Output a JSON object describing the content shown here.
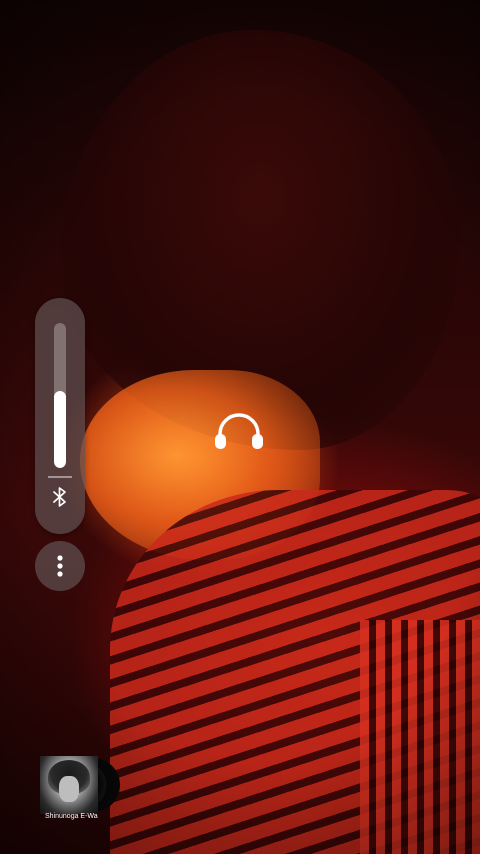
{
  "player": {
    "track_caption": "Shinunoga E-Wa",
    "output_device_icon": "headphones-icon",
    "volume_level": 0.53
  },
  "controls": {
    "bluetooth_icon": "bluetooth-icon",
    "more_icon": "more-vert-icon"
  },
  "colors": {
    "panel_bg": "#5f5050",
    "accent": "#ffffff"
  }
}
